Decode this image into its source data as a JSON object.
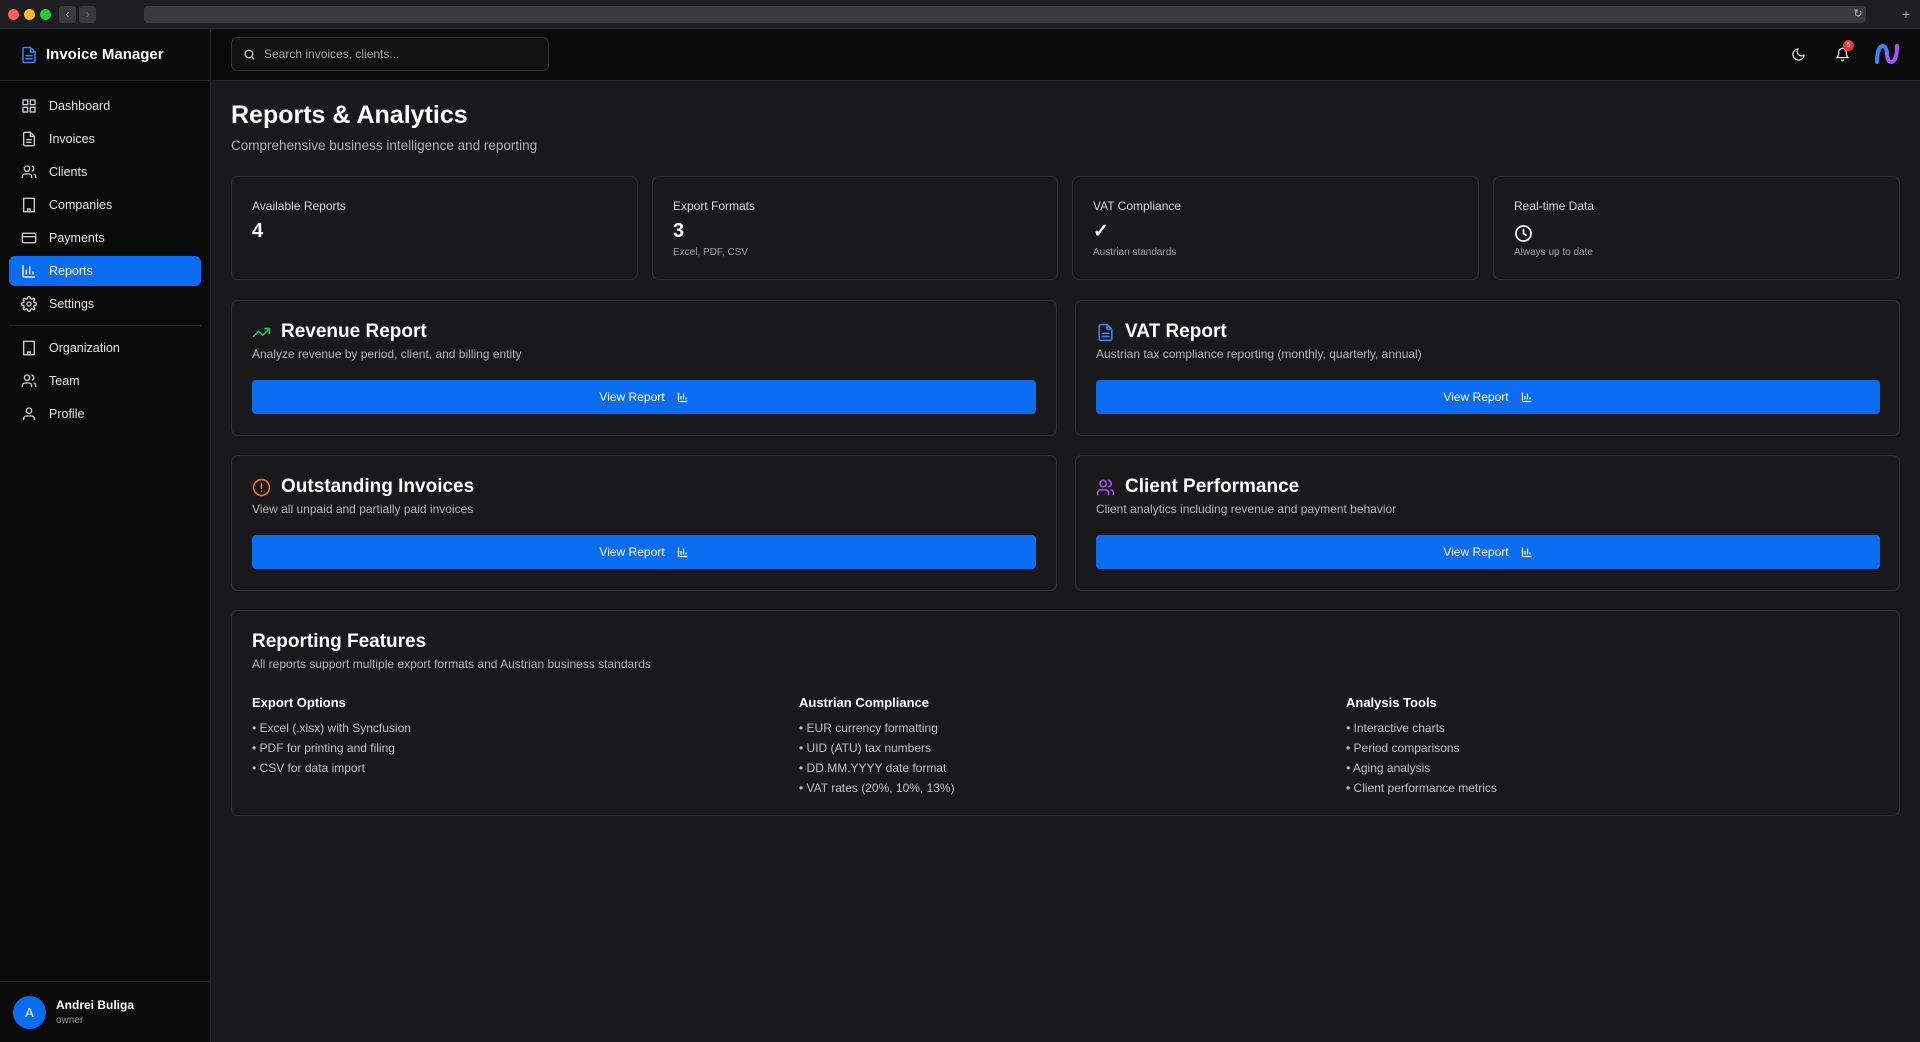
{
  "app": {
    "title": "Invoice Manager"
  },
  "sidebar": {
    "items": [
      {
        "label": "Dashboard",
        "icon": "dashboard-icon"
      },
      {
        "label": "Invoices",
        "icon": "file-icon"
      },
      {
        "label": "Clients",
        "icon": "users-icon"
      },
      {
        "label": "Companies",
        "icon": "building-icon"
      },
      {
        "label": "Payments",
        "icon": "credit-card-icon"
      },
      {
        "label": "Reports",
        "icon": "bar-chart-icon",
        "active": true
      },
      {
        "label": "Settings",
        "icon": "gear-icon"
      }
    ],
    "secondary": [
      {
        "label": "Organization",
        "icon": "building-icon"
      },
      {
        "label": "Team",
        "icon": "users-icon"
      },
      {
        "label": "Profile",
        "icon": "user-icon"
      }
    ]
  },
  "user": {
    "initial": "A",
    "name": "Andrei Buliga",
    "role": "owner"
  },
  "topbar": {
    "search_placeholder": "Search invoices, clients...",
    "notification_count": "5"
  },
  "page": {
    "title": "Reports & Analytics",
    "subtitle": "Comprehensive business intelligence and reporting"
  },
  "stats": [
    {
      "label": "Available Reports",
      "value": "4",
      "note": ""
    },
    {
      "label": "Export Formats",
      "value": "3",
      "note": "Excel, PDF, CSV"
    },
    {
      "label": "VAT Compliance",
      "value": "✓",
      "note": "Austrian standards"
    },
    {
      "label": "Real-time Data",
      "value": "",
      "note": "Always up to date"
    }
  ],
  "reports": [
    {
      "title": "Revenue Report",
      "description": "Analyze revenue by period, client, and billing entity",
      "button": "View Report"
    },
    {
      "title": "VAT Report",
      "description": "Austrian tax compliance reporting (monthly, quarterly, annual)",
      "button": "View Report"
    },
    {
      "title": "Outstanding Invoices",
      "description": "View all unpaid and partially paid invoices",
      "button": "View Report"
    },
    {
      "title": "Client Performance",
      "description": "Client analytics including revenue and payment behavior",
      "button": "View Report"
    }
  ],
  "features": {
    "title": "Reporting Features",
    "subtitle": "All reports support multiple export formats and Austrian business standards",
    "columns": [
      {
        "title": "Export Options",
        "items": [
          "• Excel (.xlsx) with Syncfusion",
          "• PDF for printing and filing",
          "• CSV for data import"
        ]
      },
      {
        "title": "Austrian Compliance",
        "items": [
          "• EUR currency formatting",
          "• UID (ATU) tax numbers",
          "• DD.MM.YYYY date format",
          "• VAT rates (20%, 10%, 13%)"
        ]
      },
      {
        "title": "Analysis Tools",
        "items": [
          "• Interactive charts",
          "• Period comparisons",
          "• Aging analysis",
          "• Client performance metrics"
        ]
      }
    ]
  },
  "colors": {
    "accent": "#0a6cf0",
    "revenue": "#22c55e",
    "vat": "#3b82f6",
    "outstanding": "#f97316",
    "client": "#a855f7"
  }
}
